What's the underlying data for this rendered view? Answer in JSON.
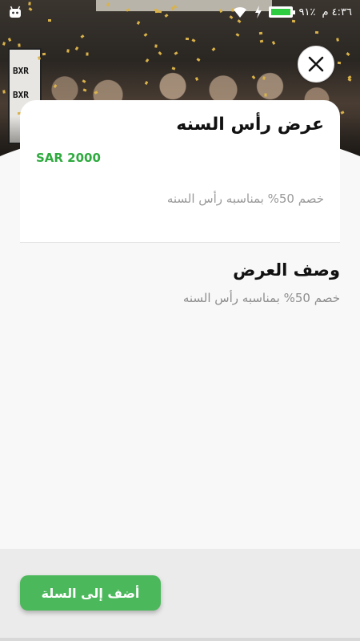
{
  "status_bar": {
    "time": "٤:٣٦ م",
    "battery_text": "٩١٪",
    "battery_level": 0.91,
    "icons": [
      "android-notification-icon",
      "wifi-icon",
      "charging-icon",
      "battery-icon"
    ]
  },
  "offer": {
    "title": "عرض رأس السنه",
    "price": "SAR 2000",
    "subtitle": "خصم 50% بمناسبه رأس السنه"
  },
  "description": {
    "heading": "وصف العرض",
    "text": "خصم 50% بمناسبه رأس السنه"
  },
  "actions": {
    "add_to_cart_label": "أضف إلى السلة",
    "close_icon": "close-icon"
  },
  "colors": {
    "accent_green": "#4cb85c",
    "price_green": "#2faa3f",
    "background": "#f8f8f8"
  }
}
